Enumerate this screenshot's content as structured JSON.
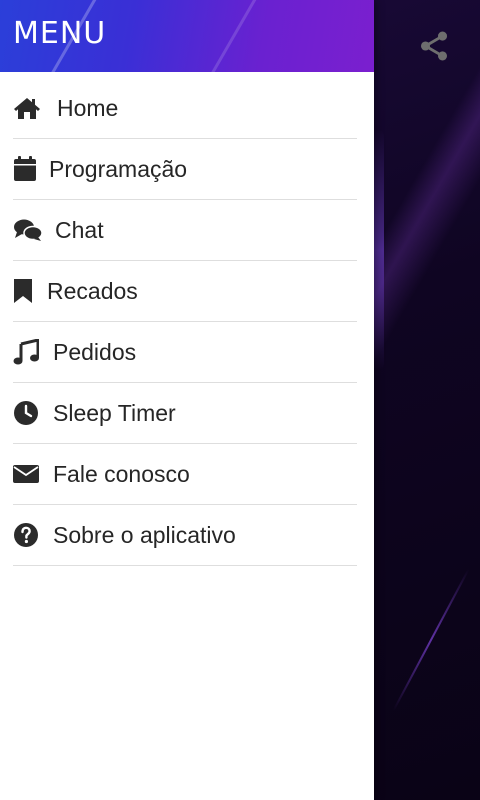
{
  "drawer": {
    "title": "MENU",
    "items": [
      {
        "label": "Home",
        "icon": "home-icon"
      },
      {
        "label": "Programação",
        "icon": "calendar-icon"
      },
      {
        "label": "Chat",
        "icon": "chat-icon"
      },
      {
        "label": "Recados",
        "icon": "bookmark-icon"
      },
      {
        "label": "Pedidos",
        "icon": "music-note-icon"
      },
      {
        "label": "Sleep Timer",
        "icon": "clock-icon"
      },
      {
        "label": "Fale conosco",
        "icon": "envelope-icon"
      },
      {
        "label": "Sobre o aplicativo",
        "icon": "question-circle-icon"
      }
    ]
  },
  "background": {
    "share_icon": "share-icon"
  },
  "colors": {
    "header_start": "#2b3fd9",
    "header_end": "#7b1fcf",
    "text": "#262626",
    "divider": "#dedede",
    "icon": "#2b2b2b"
  }
}
